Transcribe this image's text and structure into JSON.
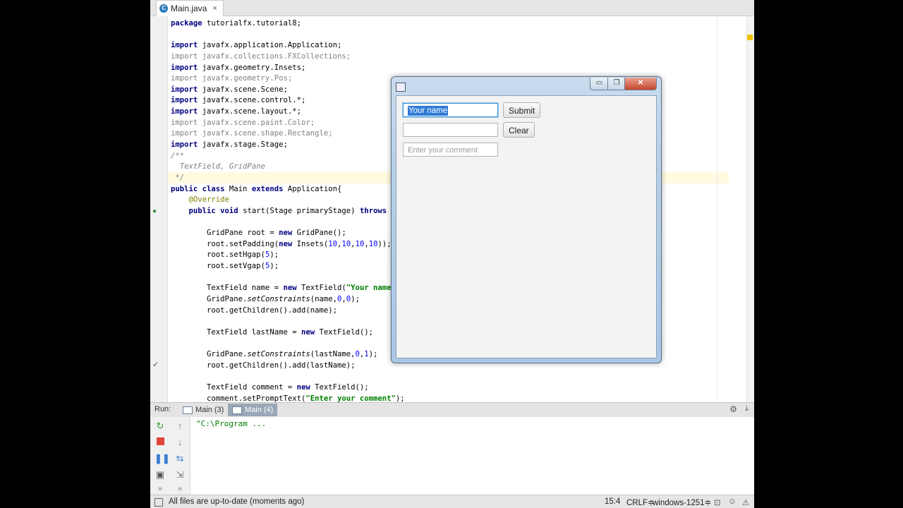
{
  "editor_tab": {
    "file_name": "Main.java",
    "close_glyph": "×",
    "icon": "java-class-icon"
  },
  "code_lines": [
    [
      {
        "t": "package",
        "c": "kw"
      },
      {
        "t": " tutorialfx.tutorial8;"
      }
    ],
    [],
    [
      {
        "t": "import",
        "c": "kw"
      },
      {
        "t": " javafx.application.Application;"
      }
    ],
    [
      {
        "t": "import javafx.collections.FXCollections;",
        "c": "gr"
      }
    ],
    [
      {
        "t": "import",
        "c": "kw"
      },
      {
        "t": " javafx.geometry.Insets;"
      }
    ],
    [
      {
        "t": "import javafx.geometry.Pos;",
        "c": "gr"
      }
    ],
    [
      {
        "t": "import",
        "c": "kw"
      },
      {
        "t": " javafx.scene.Scene;"
      }
    ],
    [
      {
        "t": "import",
        "c": "kw"
      },
      {
        "t": " javafx.scene.control.*;"
      }
    ],
    [
      {
        "t": "import",
        "c": "kw"
      },
      {
        "t": " javafx.scene.layout.*;"
      }
    ],
    [
      {
        "t": "import javafx.scene.paint.Color;",
        "c": "gr"
      }
    ],
    [
      {
        "t": "import javafx.scene.shape.Rectangle;",
        "c": "gr"
      }
    ],
    [
      {
        "t": "import",
        "c": "kw"
      },
      {
        "t": " javafx.stage.Stage;"
      }
    ],
    [
      {
        "t": "/**",
        "c": "gr it"
      }
    ],
    [
      {
        "t": "  "
      },
      {
        "t": "TextField, GridPane",
        "c": "gr it"
      }
    ],
    [
      {
        "t": " */",
        "c": "gr it"
      }
    ],
    [
      {
        "t": "public class",
        "c": "kw"
      },
      {
        "t": " Main "
      },
      {
        "t": "extends",
        "c": "kw"
      },
      {
        "t": " Application{"
      }
    ],
    [
      {
        "t": "    "
      },
      {
        "t": "@Override",
        "c": "ann"
      }
    ],
    [
      {
        "t": "    "
      },
      {
        "t": "public void",
        "c": "kw"
      },
      {
        "t": " start(Stage primaryStage) "
      },
      {
        "t": "throws",
        "c": "kw"
      }
    ],
    [],
    [
      {
        "t": "        GridPane root = "
      },
      {
        "t": "new",
        "c": "kw"
      },
      {
        "t": " GridPane();"
      }
    ],
    [
      {
        "t": "        root.setPadding("
      },
      {
        "t": "new",
        "c": "kw"
      },
      {
        "t": " Insets("
      },
      {
        "t": "10",
        "c": "num"
      },
      {
        "t": ","
      },
      {
        "t": "10",
        "c": "num"
      },
      {
        "t": ","
      },
      {
        "t": "10",
        "c": "num"
      },
      {
        "t": ","
      },
      {
        "t": "10",
        "c": "num"
      },
      {
        "t": "));"
      }
    ],
    [
      {
        "t": "        root.setHgap("
      },
      {
        "t": "5",
        "c": "num"
      },
      {
        "t": ");"
      }
    ],
    [
      {
        "t": "        root.setVgap("
      },
      {
        "t": "5",
        "c": "num"
      },
      {
        "t": ");"
      }
    ],
    [],
    [
      {
        "t": "        TextField name = "
      },
      {
        "t": "new",
        "c": "kw"
      },
      {
        "t": " TextField("
      },
      {
        "t": "\"Your name",
        "c": "st"
      }
    ],
    [
      {
        "t": "        GridPane."
      },
      {
        "t": "setConstraints",
        "c": "it"
      },
      {
        "t": "(name,"
      },
      {
        "t": "0",
        "c": "num"
      },
      {
        "t": ","
      },
      {
        "t": "0",
        "c": "num"
      },
      {
        "t": ");"
      }
    ],
    [
      {
        "t": "        root.getChildren().add(name);"
      }
    ],
    [],
    [
      {
        "t": "        TextField lastName = "
      },
      {
        "t": "new",
        "c": "kw"
      },
      {
        "t": " TextField();"
      }
    ],
    [],
    [
      {
        "t": "        GridPane."
      },
      {
        "t": "setConstraints",
        "c": "it"
      },
      {
        "t": "(lastName,"
      },
      {
        "t": "0",
        "c": "num"
      },
      {
        "t": ","
      },
      {
        "t": "1",
        "c": "num"
      },
      {
        "t": ");"
      }
    ],
    [
      {
        "t": "        root.getChildren().add(lastName);"
      }
    ],
    [],
    [
      {
        "t": "        TextField comment = "
      },
      {
        "t": "new",
        "c": "kw"
      },
      {
        "t": " TextField();"
      }
    ],
    [
      {
        "t": "        comment.setPromptText("
      },
      {
        "t": "\"Enter your comment\"",
        "c": "st"
      },
      {
        "t": ");"
      }
    ]
  ],
  "run_panel": {
    "label": "Run:",
    "tabs": [
      {
        "label": "Main (3)",
        "active": false
      },
      {
        "label": "Main (4)",
        "active": true
      }
    ],
    "console_text": "\"C:\\Program ..."
  },
  "status_bar": {
    "message": "All files are up-to-date (moments ago)",
    "position": "15:4",
    "line_separator": "CRLF≑",
    "encoding": "windows-1251≑"
  },
  "fx_window": {
    "name_field": {
      "value": "Your name"
    },
    "submit_button": "Submit",
    "clear_button": "Clear",
    "comment_field": {
      "placeholder": "Enter your comment"
    },
    "close_glyph": "✕",
    "minimize_glyph": "▭",
    "maximize_glyph": "❐"
  }
}
